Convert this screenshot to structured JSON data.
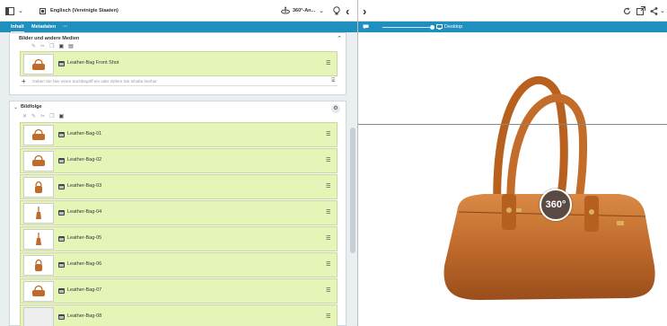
{
  "toolbar": {
    "language": "Englisch (Vereinigte Staaten)",
    "view_select": "360°-An...",
    "back_glyph": "‹",
    "forward_glyph": "›"
  },
  "tabs": [
    {
      "label": "Inhalt"
    },
    {
      "label": "Metadaten"
    },
    {
      "label": "···"
    }
  ],
  "preview": {
    "device_label": "Desktop",
    "badge": "360°"
  },
  "media_section": {
    "title": "Bilder und andere Medien",
    "item_label": "Leather-Bag Front Shot",
    "search_placeholder": "Geben Sie hier einen Suchbegriff ein oder ziehen Sie Inhalte hierher"
  },
  "sequence_section": {
    "title": "Bildfolge",
    "items": [
      {
        "label": "Leather-Bag-01",
        "icon": "bag-front"
      },
      {
        "label": "Leather-Bag-02",
        "icon": "bag-front"
      },
      {
        "label": "Leather-Bag-03",
        "icon": "bag-angle"
      },
      {
        "label": "Leather-Bag-04",
        "icon": "bag-side"
      },
      {
        "label": "Leather-Bag-05",
        "icon": "bag-side"
      },
      {
        "label": "Leather-Bag-06",
        "icon": "bag-angle"
      },
      {
        "label": "Leather-Bag-07",
        "icon": "bag-front"
      },
      {
        "label": "Leather-Bag-08",
        "icon": "empty"
      }
    ]
  },
  "colors": {
    "accent": "#1f8fbe",
    "row_bg": "#e5f5b8",
    "bag": "#c06a2c"
  }
}
